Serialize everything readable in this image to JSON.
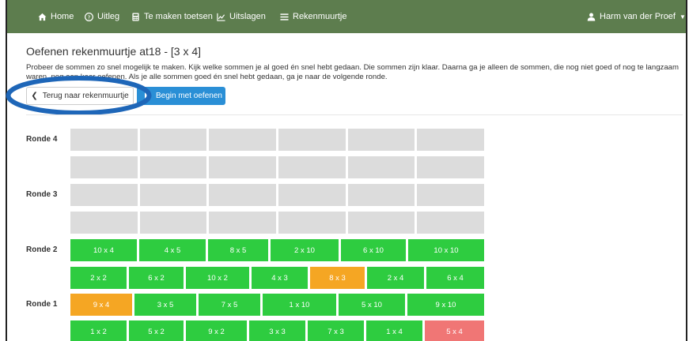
{
  "nav": {
    "home": "Home",
    "uitleg": "Uitleg",
    "toetsen": "Te maken toetsen",
    "uitslagen": "Uitslagen",
    "rekenmuurtje": "Rekenmuurtje",
    "user": "Harm van der Proef"
  },
  "page": {
    "title": "Oefenen rekenmuurtje at18 - [3 x 4]",
    "intro": "Probeer de sommen zo snel mogelijk te maken. Kijk welke sommen je al goed én snel hebt gedaan. Die sommen zijn klaar. Daarna ga je alleen de sommen, die nog niet goed of nog te langzaam waren, nog een keer oefenen. Als je alle sommen goed én snel hebt gedaan, ga je naar de volgende ronde.",
    "back_button": "Terug naar rekenmuurtje",
    "start_button": "Begin met oefenen"
  },
  "colors": {
    "navbar": "#5d7d4e",
    "good": "#2ecc40",
    "slow": "#f5a623",
    "wrong": "#f07675",
    "empty": "#dcdcdc",
    "primary": "#2a8fd6",
    "highlight": "#1e66b8"
  },
  "rounds": {
    "r4": "Ronde 4",
    "r3": "Ronde 3",
    "r2": "Ronde 2",
    "r1": "Ronde 1"
  },
  "round2": {
    "row_a": [
      {
        "label": "10 x 4",
        "status": "good"
      },
      {
        "label": "4 x 5",
        "status": "good"
      },
      {
        "label": "8 x 5",
        "status": "good"
      },
      {
        "label": "2 x 10",
        "status": "good"
      },
      {
        "label": "6 x 10",
        "status": "good"
      },
      {
        "label": "10 x 10",
        "status": "good"
      }
    ],
    "row_b": [
      {
        "label": "2 x 2",
        "status": "good"
      },
      {
        "label": "6 x 2",
        "status": "good"
      },
      {
        "label": "10 x 2",
        "status": "good"
      },
      {
        "label": "4 x 3",
        "status": "good"
      },
      {
        "label": "8 x 3",
        "status": "slow"
      },
      {
        "label": "2 x 4",
        "status": "good"
      },
      {
        "label": "6 x 4",
        "status": "good"
      }
    ]
  },
  "round1": {
    "row_a": [
      {
        "label": "9 x 4",
        "status": "slow"
      },
      {
        "label": "3 x 5",
        "status": "good"
      },
      {
        "label": "7 x 5",
        "status": "good"
      },
      {
        "label": "1 x 10",
        "status": "good"
      },
      {
        "label": "5 x 10",
        "status": "good"
      },
      {
        "label": "9 x 10",
        "status": "good"
      }
    ],
    "row_b": [
      {
        "label": "1 x 2",
        "status": "good"
      },
      {
        "label": "5 x 2",
        "status": "good"
      },
      {
        "label": "9 x 2",
        "status": "good"
      },
      {
        "label": "3 x 3",
        "status": "good"
      },
      {
        "label": "7 x 3",
        "status": "good"
      },
      {
        "label": "1 x 4",
        "status": "good"
      },
      {
        "label": "5 x 4",
        "status": "wrong"
      }
    ]
  }
}
